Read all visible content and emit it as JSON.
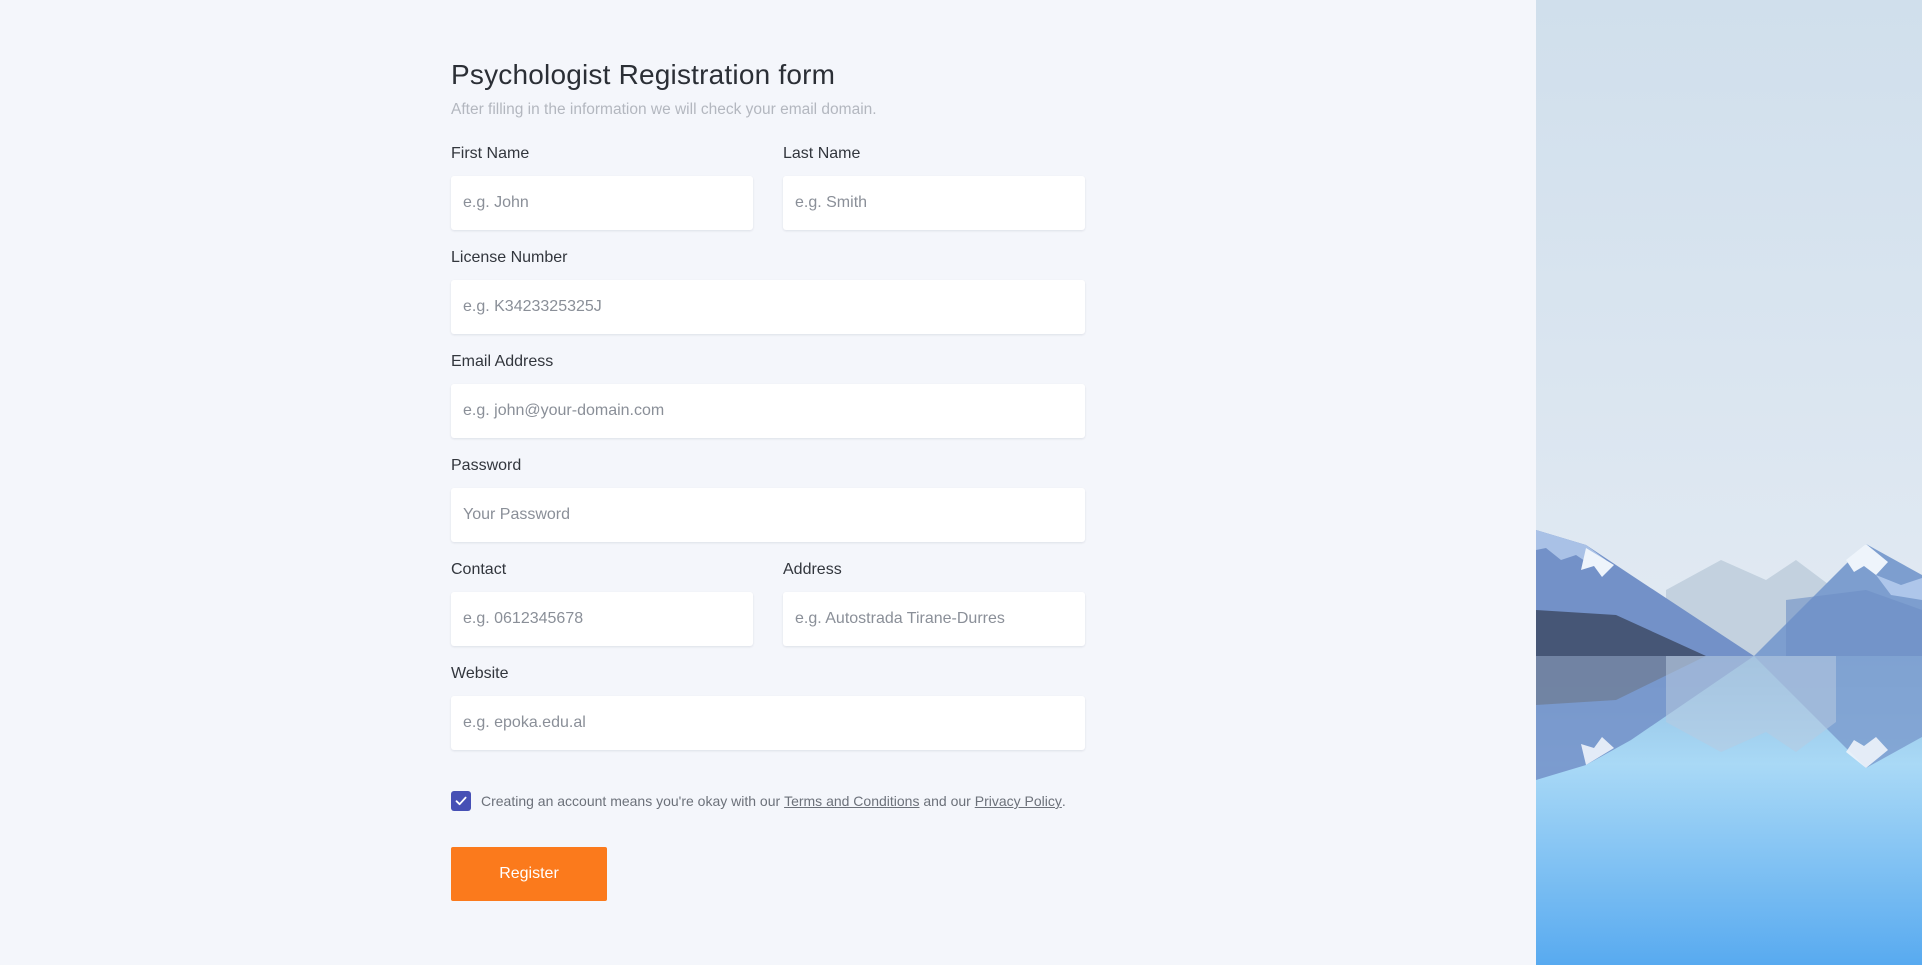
{
  "form": {
    "title": "Psychologist Registration form",
    "subtitle": "After filling in the information we will check your email domain.",
    "fields": {
      "first_name": {
        "label": "First Name",
        "placeholder": "e.g. John",
        "value": ""
      },
      "last_name": {
        "label": "Last Name",
        "placeholder": "e.g. Smith",
        "value": ""
      },
      "license": {
        "label": "License Number",
        "placeholder": "e.g. K3423325325J",
        "value": ""
      },
      "email": {
        "label": "Email Address",
        "placeholder": "e.g. john@your-domain.com",
        "value": ""
      },
      "password": {
        "label": "Password",
        "placeholder": "Your Password",
        "value": ""
      },
      "contact": {
        "label": "Contact",
        "placeholder": "e.g. 0612345678",
        "value": ""
      },
      "address": {
        "label": "Address",
        "placeholder": "e.g. Autostrada Tirane-Durres",
        "value": ""
      },
      "website": {
        "label": "Website",
        "placeholder": "e.g. epoka.edu.al",
        "value": ""
      }
    },
    "consent": {
      "checked": true,
      "text_before": "Creating an account means you're okay with our ",
      "terms_link": "Terms and Conditions",
      "text_middle": " and our ",
      "privacy_link": "Privacy Policy",
      "text_after": "."
    },
    "register_label": "Register"
  },
  "icons": {
    "checkbox": "check-icon",
    "scenery": "mountain-lake-illustration"
  },
  "colors": {
    "background": "#f4f6fb",
    "accent_button": "#fb7a1c",
    "checkbox": "#4650b5",
    "sky_top": "#d3e0ec",
    "water_bottom": "#5aaef0"
  }
}
